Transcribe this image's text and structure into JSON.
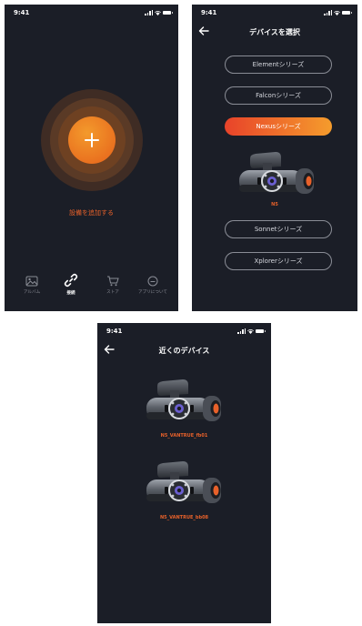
{
  "status": {
    "time": "9:41"
  },
  "home": {
    "add_device_label": "設備を追加する",
    "tabs": [
      {
        "label": "アルバム",
        "icon": "album-icon"
      },
      {
        "label": "接続",
        "icon": "link-icon"
      },
      {
        "label": "ストア",
        "icon": "cart-icon"
      },
      {
        "label": "アプリについて",
        "icon": "info-icon"
      }
    ]
  },
  "select": {
    "title": "デバイスを選択",
    "series": [
      {
        "label": "Elementシリーズ"
      },
      {
        "label": "Falconシリーズ"
      },
      {
        "label": "Nexusシリーズ"
      },
      {
        "label": "Sonnetシリーズ"
      },
      {
        "label": "Xplorerシリーズ"
      }
    ],
    "selected_index": 2,
    "model": "N5"
  },
  "nearby": {
    "title": "近くのデバイス",
    "devices": [
      {
        "name": "N5_VANTRUE_fb01"
      },
      {
        "name": "N5_VANTRUE_bb08"
      }
    ]
  },
  "colors": {
    "background": "#1b1e27",
    "accent": "#e8612a",
    "gradient_start": "#e8432a",
    "gradient_end": "#f59c2c"
  }
}
